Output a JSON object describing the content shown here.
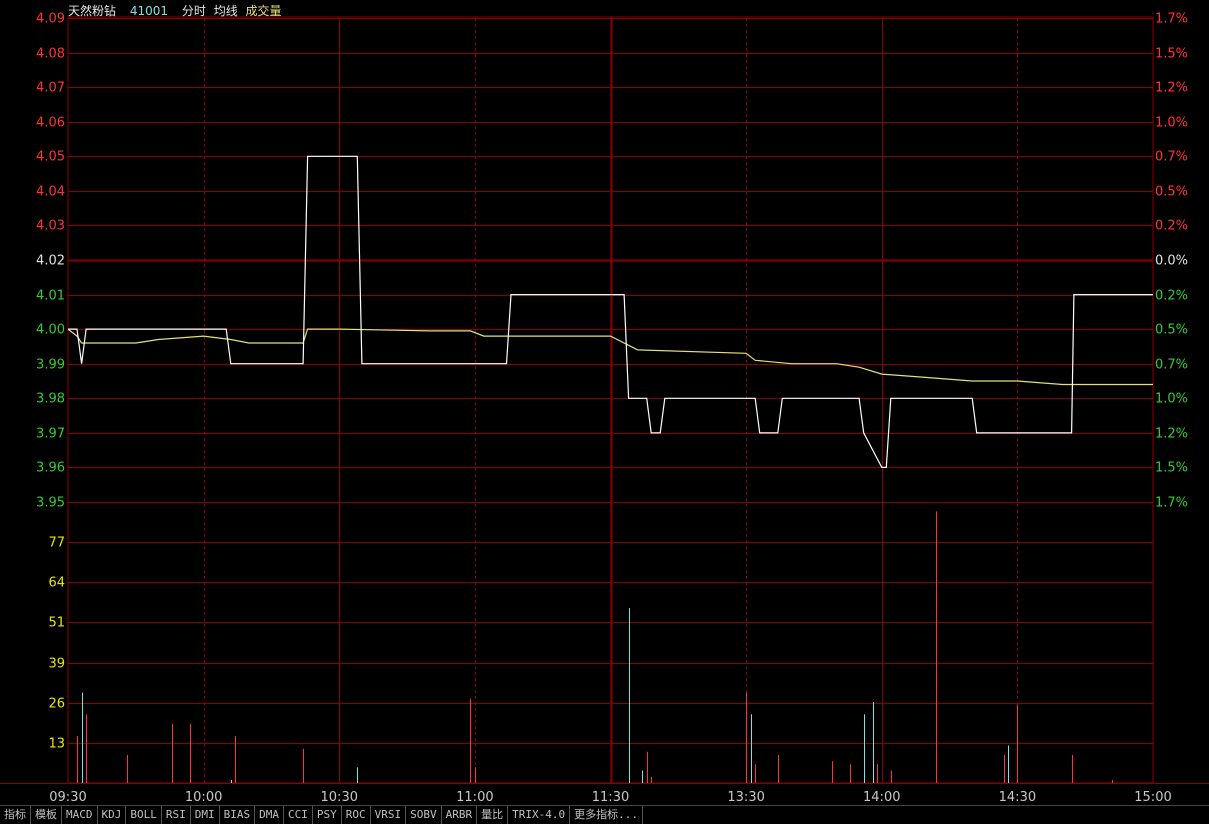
{
  "header": {
    "name": "天然粉钻",
    "code": "41001",
    "mode": "分时",
    "avg_label": "均线",
    "vol_label": "成交量"
  },
  "colors": {
    "background": "#000000",
    "grid": "#8b0000",
    "up": "#ff3333",
    "down": "#33cc33",
    "flat": "#e0e0e0",
    "price_line": "#ffffff",
    "avg_line": "#e5e07a",
    "vol_up": "#ff3333",
    "vol_down": "#7ee0e0",
    "vol_axis": "#e8e800",
    "time_axis": "#c8c8c8"
  },
  "tabs": [
    "指标",
    "模板",
    "MACD",
    "KDJ",
    "BOLL",
    "RSI",
    "DMI",
    "BIAS",
    "DMA",
    "CCI",
    "PSY",
    "ROC",
    "VRSI",
    "SOBV",
    "ARBR",
    "量比",
    "TRIX-4.0",
    "更多指标..."
  ],
  "chart_data": {
    "type": "line",
    "prev_close": 4.02,
    "price_axis": {
      "ylim": [
        3.95,
        4.09
      ],
      "ticks": [
        "4.09",
        "4.08",
        "4.07",
        "4.06",
        "4.05",
        "4.04",
        "4.03",
        "4.02",
        "4.01",
        "4.00",
        "3.99",
        "3.98",
        "3.97",
        "3.96",
        "3.95"
      ]
    },
    "pct_axis": {
      "ticks": [
        "1.7%",
        "1.5%",
        "1.2%",
        "1.0%",
        "0.7%",
        "0.5%",
        "0.2%",
        "0.0%",
        "0.2%",
        "0.5%",
        "0.7%",
        "1.0%",
        "1.2%",
        "1.5%",
        "1.7%"
      ]
    },
    "time_axis": {
      "labels": [
        "09:30",
        "10:00",
        "10:30",
        "11:00",
        "11:30",
        "13:30",
        "14:00",
        "14:30",
        "15:00"
      ],
      "total_minutes": 240,
      "ticks_minutes": [
        0,
        30,
        60,
        90,
        120,
        150,
        180,
        210,
        240
      ]
    },
    "price": {
      "x": [
        0,
        2,
        3,
        4,
        35,
        36,
        52,
        53,
        64,
        65,
        75,
        76,
        97,
        98,
        123,
        124,
        128,
        129,
        131,
        132,
        152,
        153,
        157,
        158,
        175,
        176,
        180,
        181,
        182,
        183,
        200,
        201,
        221,
        222,
        222.5,
        240
      ],
      "y": [
        4.0,
        4.0,
        3.99,
        4.0,
        4.0,
        3.99,
        3.99,
        4.05,
        4.05,
        3.99,
        3.99,
        3.99,
        3.99,
        4.01,
        4.01,
        3.98,
        3.98,
        3.97,
        3.97,
        3.98,
        3.98,
        3.97,
        3.97,
        3.98,
        3.98,
        3.97,
        3.96,
        3.96,
        3.98,
        3.98,
        3.98,
        3.97,
        3.97,
        3.97,
        4.01,
        4.01
      ]
    },
    "average": {
      "x": [
        0,
        2,
        3,
        8,
        15,
        20,
        30,
        36,
        40,
        52,
        53,
        60,
        80,
        89,
        92,
        120,
        126,
        150,
        152,
        160,
        170,
        175,
        180,
        190,
        200,
        210,
        220,
        240
      ],
      "y": [
        4.0,
        3.998,
        3.996,
        3.996,
        3.996,
        3.997,
        3.998,
        3.997,
        3.996,
        3.996,
        4.0,
        4.0,
        3.9995,
        3.9995,
        3.998,
        3.998,
        3.994,
        3.993,
        3.991,
        3.99,
        3.99,
        3.989,
        3.987,
        3.986,
        3.985,
        3.985,
        3.984,
        3.984
      ]
    },
    "volume": {
      "ylim": [
        0,
        90
      ],
      "ticks": [
        "77",
        "64",
        "51",
        "39",
        "26",
        "13"
      ],
      "bars": [
        {
          "t": 2,
          "v": 15,
          "d": "up"
        },
        {
          "t": 3,
          "v": 29,
          "d": "down"
        },
        {
          "t": 4,
          "v": 22,
          "d": "up"
        },
        {
          "t": 13,
          "v": 9,
          "d": "up"
        },
        {
          "t": 23,
          "v": 19,
          "d": "up"
        },
        {
          "t": 27,
          "v": 19,
          "d": "up"
        },
        {
          "t": 36,
          "v": 1,
          "d": "down"
        },
        {
          "t": 37,
          "v": 15,
          "d": "up"
        },
        {
          "t": 52,
          "v": 11,
          "d": "up"
        },
        {
          "t": 64,
          "v": 5,
          "d": "down"
        },
        {
          "t": 89,
          "v": 27,
          "d": "up"
        },
        {
          "t": 90,
          "v": 5,
          "d": "up"
        },
        {
          "t": 124,
          "v": 56,
          "d": "down"
        },
        {
          "t": 127,
          "v": 4,
          "d": "down"
        },
        {
          "t": 128,
          "v": 10,
          "d": "up"
        },
        {
          "t": 129,
          "v": 2,
          "d": "up"
        },
        {
          "t": 150,
          "v": 29,
          "d": "up"
        },
        {
          "t": 151,
          "v": 22,
          "d": "down"
        },
        {
          "t": 152,
          "v": 6,
          "d": "up"
        },
        {
          "t": 157,
          "v": 9,
          "d": "up"
        },
        {
          "t": 169,
          "v": 7,
          "d": "up"
        },
        {
          "t": 173,
          "v": 6,
          "d": "up"
        },
        {
          "t": 176,
          "v": 22,
          "d": "down"
        },
        {
          "t": 178,
          "v": 26,
          "d": "down"
        },
        {
          "t": 179,
          "v": 6,
          "d": "up"
        },
        {
          "t": 182,
          "v": 4,
          "d": "up"
        },
        {
          "t": 192,
          "v": 87,
          "d": "up"
        },
        {
          "t": 207,
          "v": 9,
          "d": "up"
        },
        {
          "t": 208,
          "v": 12,
          "d": "down"
        },
        {
          "t": 210,
          "v": 25,
          "d": "up"
        },
        {
          "t": 222,
          "v": 9,
          "d": "up"
        },
        {
          "t": 231,
          "v": 1,
          "d": "up"
        }
      ]
    }
  }
}
